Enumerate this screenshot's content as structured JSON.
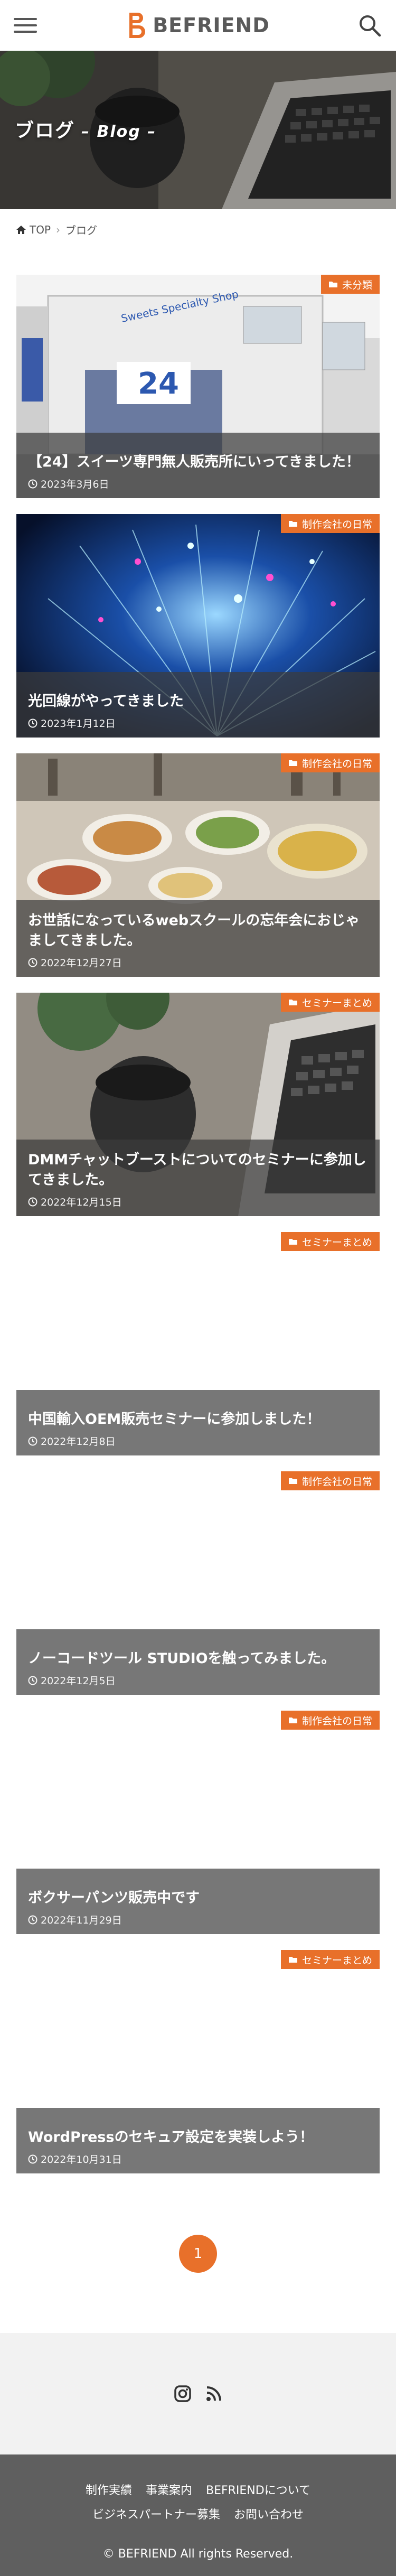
{
  "header": {
    "logo_text": "BEFRIEND"
  },
  "hero": {
    "title": "ブログ",
    "subtitle": "– Blog –"
  },
  "breadcrumb": {
    "home": "TOP",
    "current": "ブログ"
  },
  "posts": [
    {
      "title": "【24】スイーツ専門無人販売所にいってきました！",
      "date": "2023年3月6日",
      "category": "未分類"
    },
    {
      "title": "光回線がやってきました",
      "date": "2023年1月12日",
      "category": "制作会社の日常"
    },
    {
      "title": "お世話になっているwebスクールの忘年会におじゃましてきました。",
      "date": "2022年12月27日",
      "category": "制作会社の日常"
    },
    {
      "title": "DMMチャットブーストについてのセミナーに参加してきました。",
      "date": "2022年12月15日",
      "category": "セミナーまとめ"
    },
    {
      "title": "中国輸入OEM販売セミナーに参加しました！",
      "date": "2022年12月8日",
      "category": "セミナーまとめ"
    },
    {
      "title": "ノーコードツール STUDIOを触ってみました。",
      "date": "2022年12月5日",
      "category": "制作会社の日常"
    },
    {
      "title": "ボクサーパンツ販売中です",
      "date": "2022年11月29日",
      "category": "制作会社の日常"
    },
    {
      "title": "WordPressのセキュア設定を実装しよう！",
      "date": "2022年10月31日",
      "category": "セミナーまとめ"
    }
  ],
  "photo_texts": {
    "shop_sign": "Sweets Specialty Shop",
    "shop_number": "24"
  },
  "pagination": {
    "current": "1"
  },
  "footer": {
    "links_row1": [
      "制作実績",
      "事業案内",
      "BEFRIENDについて"
    ],
    "links_row2": [
      "ビジネスパートナー募集",
      "お問い合わせ"
    ],
    "copyright": "© BEFRIEND All rights Reserved."
  },
  "colors": {
    "accent": "#e8702a",
    "footer_bg": "#5f5f5f",
    "caption_bg": "#777777"
  }
}
